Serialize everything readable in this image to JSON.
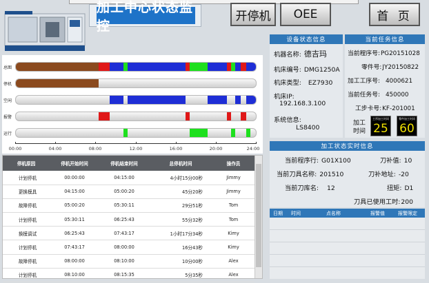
{
  "header": {
    "title": "加工中心状态监控",
    "btn_switch": "开停机",
    "btn_oee": "OEE",
    "btn_home": "首 页"
  },
  "gantt": {
    "rows": [
      "总图",
      "停机",
      "空闲",
      "报警",
      "运行"
    ],
    "ticks": [
      "00:00",
      "04:00",
      "08:00",
      "12:00",
      "16:00",
      "20:00",
      "24:00"
    ],
    "colors": {
      "stop": "#8b4a1e",
      "idle": "#1e2ed6",
      "alarm": "#e01818",
      "run": "#1ee01e"
    }
  },
  "table": {
    "headers": [
      "停机原因",
      "停机开始时间",
      "停机结束时间",
      "总停机时间",
      "操作员"
    ],
    "rows": [
      [
        "计划停机",
        "00:00:00",
        "04:15:00",
        "4小时15分00秒",
        "Jimmy"
      ],
      [
        "更换模具",
        "04:15:00",
        "05:00:20",
        "45分20秒",
        "Jimmy"
      ],
      [
        "故障停机",
        "05:00:20",
        "05:30:11",
        "29分51秒",
        "Tom"
      ],
      [
        "计划停机",
        "05:30:11",
        "06:25:43",
        "55分32秒",
        "Tom"
      ],
      [
        "换模调试",
        "06:25:43",
        "07:43:17",
        "1小时17分34秒",
        "Kimy"
      ],
      [
        "计划停机",
        "07:43:17",
        "08:00:00",
        "16分43秒",
        "Kimy"
      ],
      [
        "故障停机",
        "08:00:00",
        "08:10:00",
        "10分00秒",
        "Alex"
      ],
      [
        "计划停机",
        "08:10:00",
        "08:15:35",
        "5分35秒",
        "Alex"
      ]
    ]
  },
  "device": {
    "title": "设备状态信息",
    "name_label": "机器名称:",
    "name": "德吉玛",
    "code_label": "机床编号:",
    "code": "DMG1250A",
    "type_label": "机床类型:",
    "type": "EZ7930",
    "ip_label": "机床IP:",
    "ip": "192.168.3.100",
    "sys_label": "系统信息:",
    "sys": "LS8400"
  },
  "task": {
    "title": "当前任务信息",
    "prog_label": "当前程序号:",
    "prog": "PG20151028",
    "part_label": "零件号:",
    "part": "JY20150822",
    "proc_label": "加工工序号:",
    "proc": "4000621",
    "task_label": "当前任务号:",
    "task": "450000",
    "card_label": "工步卡号:",
    "card": "KF-201001",
    "time_label_1": "加工",
    "time_label_2": "时间",
    "box1_cap": "工序加工时间",
    "box1_val": "25",
    "box2_cap": "零件加工时间",
    "box2_val": "60"
  },
  "realtime": {
    "title": "加工状态实时信息",
    "line_label": "当前程序行:",
    "line": "G01X100",
    "comp_label": "刀补值:",
    "comp": "10",
    "tool_label": "当前刀具名称:",
    "tool": "201510",
    "addr_label": "刀补地址:",
    "addr": "-20",
    "lib_label": "当前刀库名:",
    "lib": "12",
    "torque_label": "扭矩:",
    "torque": "D1",
    "used_label": "刀具已使用工时:",
    "used": "200"
  },
  "alarms": {
    "headers": [
      "日期",
      "时间",
      "点名称",
      "报警值",
      "报警限定"
    ]
  }
}
